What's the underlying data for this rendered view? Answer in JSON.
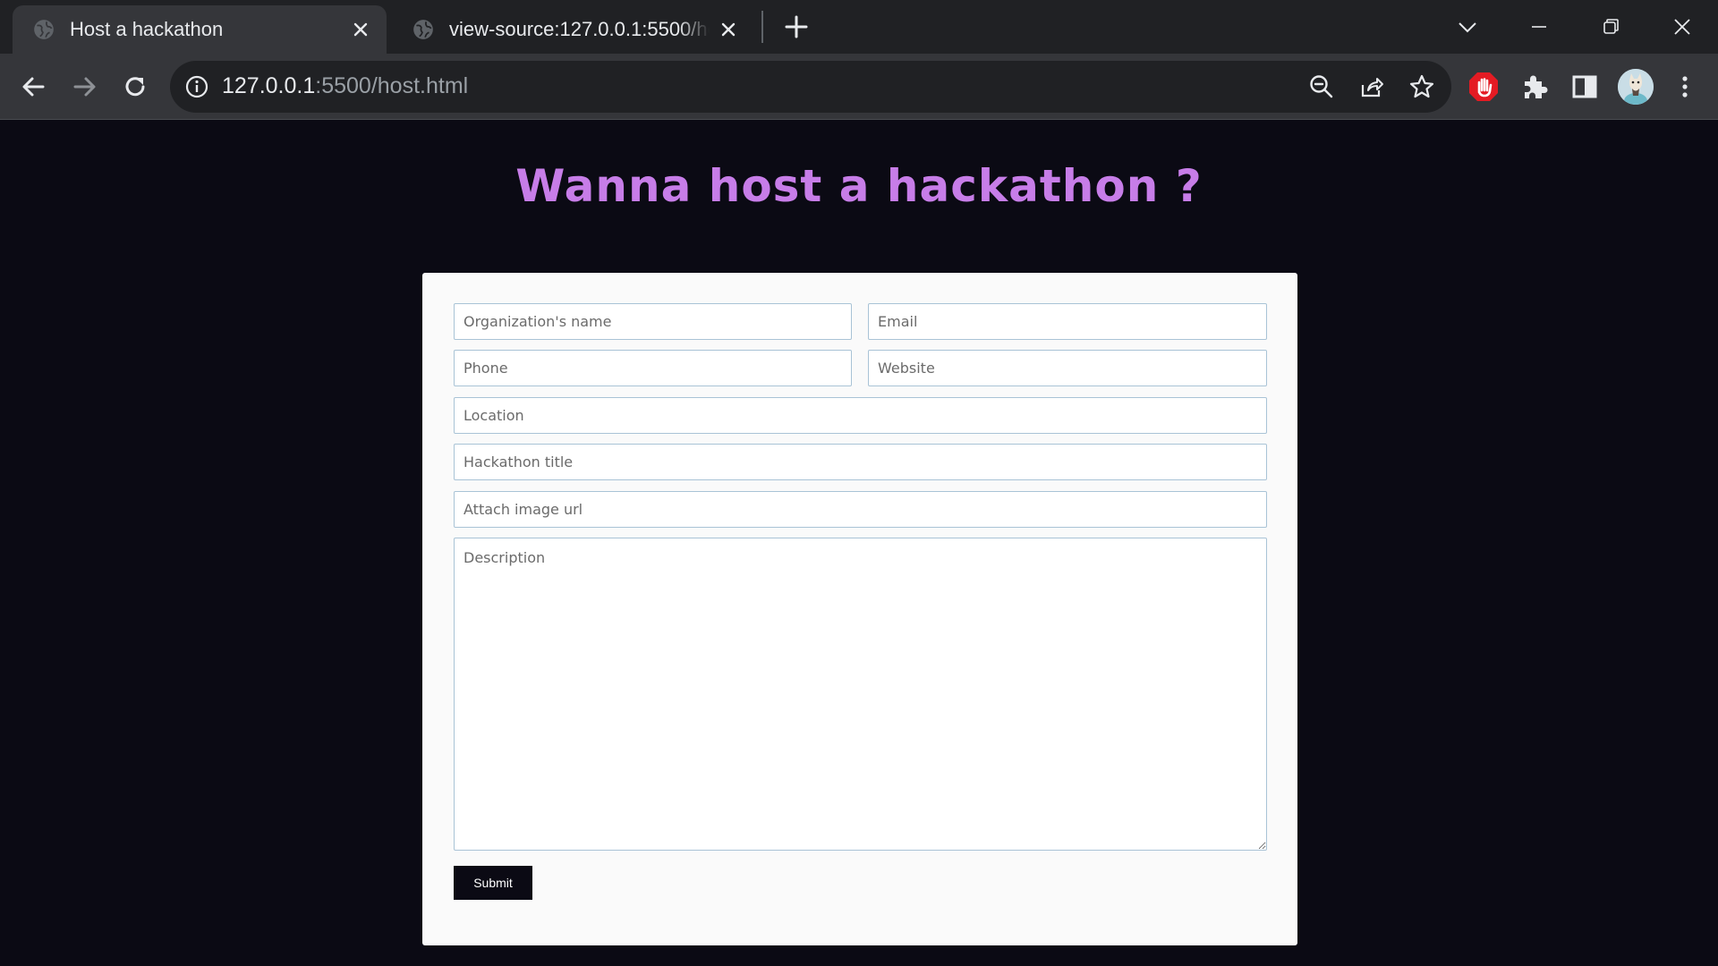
{
  "browser": {
    "tabs": [
      {
        "title": "Host a hackathon",
        "active": true
      },
      {
        "title": "view-source:127.0.0.1:5500/host.html",
        "active": false
      }
    ],
    "url_host": "127.0.0.1",
    "url_rest": ":5500/host.html"
  },
  "page": {
    "heading": "Wanna host a hackathon ?",
    "form": {
      "org_placeholder": "Organization's name",
      "email_placeholder": "Email",
      "phone_placeholder": "Phone",
      "website_placeholder": "Website",
      "location_placeholder": "Location",
      "title_placeholder": "Hackathon title",
      "image_placeholder": "Attach image url",
      "description_placeholder": "Description",
      "submit_label": "Submit"
    }
  },
  "colors": {
    "page_background": "#0b0a14",
    "heading": "#c77de8",
    "card": "#fafafa",
    "input_border": "#a9c3d6"
  }
}
